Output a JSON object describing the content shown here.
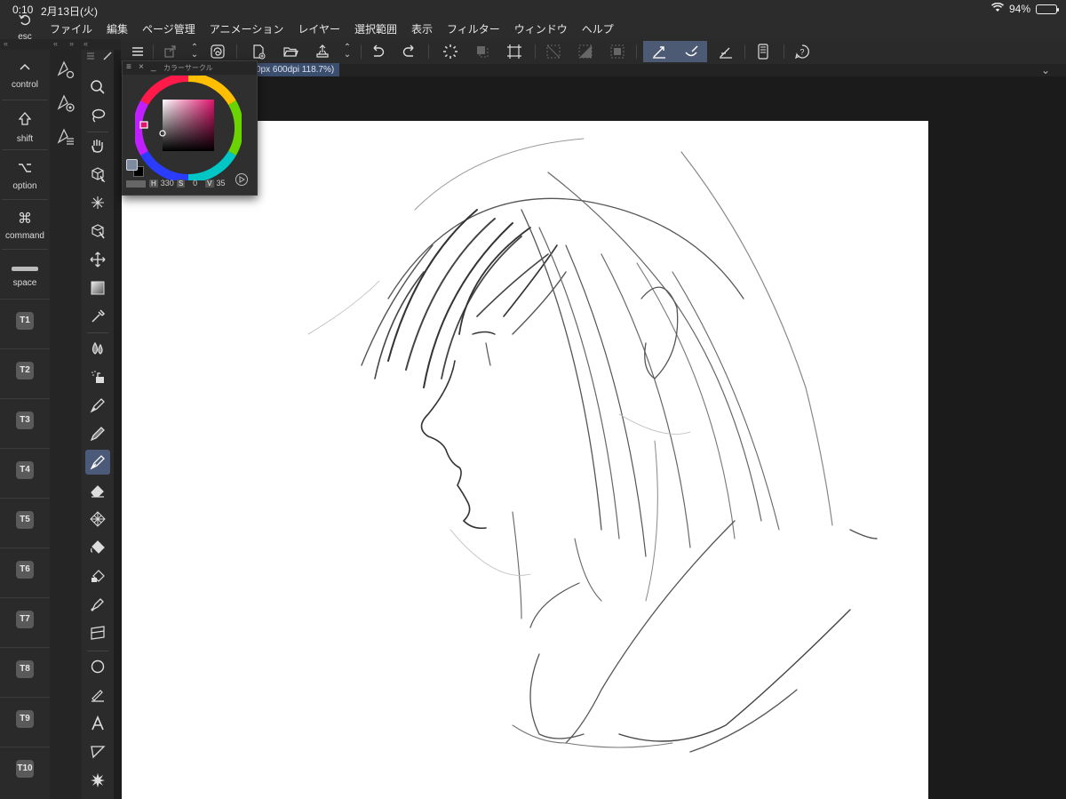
{
  "status": {
    "time": "0:10",
    "date": "2月13日(火)",
    "battery": "94%"
  },
  "menu": [
    "ファイル",
    "編集",
    "ページ管理",
    "アニメーション",
    "レイヤー",
    "選択範囲",
    "表示",
    "フィルター",
    "ウィンドウ",
    "ヘルプ"
  ],
  "modifier_keys": {
    "esc": "esc",
    "control": "control",
    "shift": "shift",
    "option": "option",
    "command": "command",
    "space": "space"
  },
  "shortcut_keys": [
    "T1",
    "T2",
    "T3",
    "T4",
    "T5",
    "T6",
    "T7",
    "T8",
    "T9",
    "T10"
  ],
  "document_tab": "0px 600dpi 118.7%)",
  "color_palette": {
    "title": "カラーサークル",
    "h_label": "H",
    "h_value": "330",
    "s_label": "S",
    "s_value": "0",
    "v_label": "V",
    "v_value": "35",
    "main_color": "#7e8aa0",
    "sub_color": "#000000"
  },
  "accent_color": "#4a5a78"
}
